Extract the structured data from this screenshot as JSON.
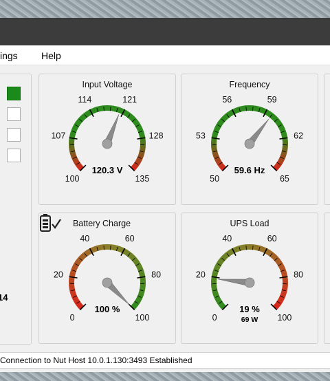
{
  "menu": {
    "settings_label": "ings",
    "help_label": "Help"
  },
  "left": {
    "indicators": [
      true,
      false,
      false,
      false
    ],
    "value": "14"
  },
  "gauges": [
    {
      "title": "Input Voltage",
      "min": 100,
      "max": 135,
      "ticks": [
        "100",
        "107",
        "114",
        "121",
        "128",
        "135"
      ],
      "value": 120.3,
      "display": "120.3 V",
      "sub": "",
      "zones": "voltage"
    },
    {
      "title": "Frequency",
      "min": 50,
      "max": 65,
      "ticks": [
        "50",
        "53",
        "56",
        "59",
        "62",
        "65"
      ],
      "value": 59.6,
      "display": "59.6 Hz",
      "sub": "",
      "zones": "voltage"
    },
    {
      "title": "Battery Charge",
      "min": 0,
      "max": 100,
      "ticks": [
        "0",
        "20",
        "40",
        "60",
        "80",
        "100"
      ],
      "value": 100,
      "display": "100 %",
      "sub": "",
      "zones": "charge"
    },
    {
      "title": "UPS Load",
      "min": 0,
      "max": 100,
      "ticks": [
        "0",
        "20",
        "40",
        "60",
        "80",
        "100"
      ],
      "value": 19,
      "display": "19 %",
      "sub": "69 W",
      "zones": "load"
    }
  ],
  "colors": {
    "green": "#2e8b1e",
    "red": "#d8261c",
    "olive": "#8c7f2a",
    "indicator_on": "#1a8a1a"
  },
  "status": {
    "text": "Connection to Nut Host 10.0.1.130:3493 Established"
  },
  "icons": {
    "battery": "battery-check-icon"
  }
}
